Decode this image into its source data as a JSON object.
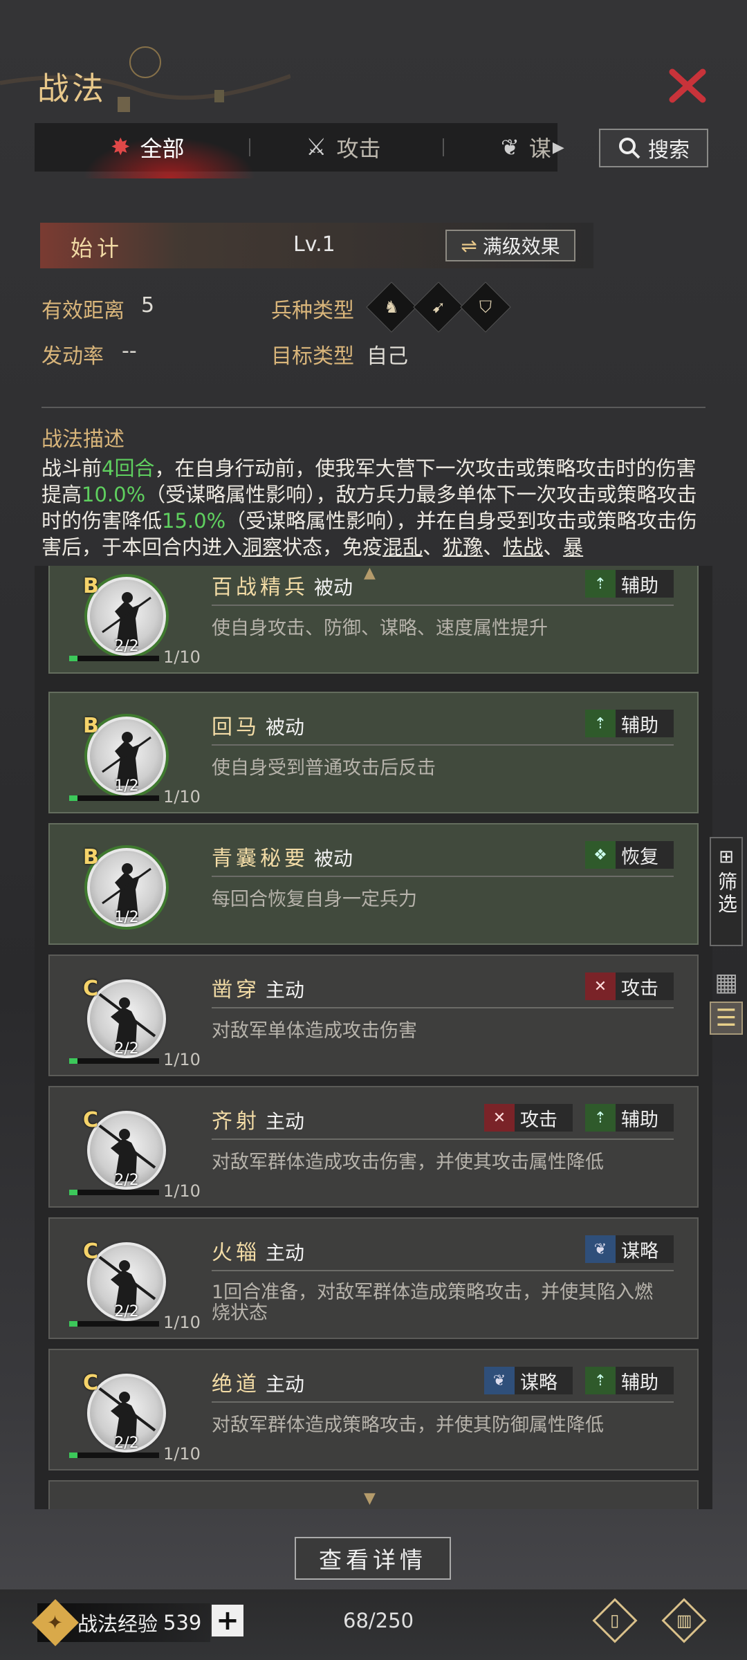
{
  "header": {
    "title": "战法"
  },
  "tabs": [
    {
      "label": "全部",
      "active": true
    },
    {
      "label": "攻击",
      "active": false
    },
    {
      "label": "谋",
      "active": false
    }
  ],
  "search": {
    "label": "搜索"
  },
  "skill": {
    "name": "始计",
    "level": "Lv.1",
    "max_effect_label": "满级效果",
    "range_label": "有效距离",
    "range_value": "5",
    "troop_label": "兵种类型",
    "rate_label": "发动率",
    "rate_value": "--",
    "target_label": "目标类型",
    "target_value": "自己",
    "desc_title": "战法描述",
    "desc": {
      "p1": "战斗前",
      "n1": "4回合",
      "p2": "，在自身行动前，使我军大营下一次攻击或策略攻击时的伤害提高",
      "n2": "10.0%",
      "p3": "（受谋略属性影响），敌方兵力最多单体下一次攻击或策略攻击时的伤害降低",
      "n3": "15.0%",
      "p4": "（受谋略属性影响），并在自身受到攻击或策略攻击伤害后，于本回合内进入",
      "u1": "洞察",
      "p5": "状态，免疫",
      "u2": "混乱",
      "s1": "、",
      "u3": "犹豫",
      "s2": "、",
      "u4": "怯战",
      "s3": "、",
      "u5": "暴"
    }
  },
  "cards": [
    {
      "grade": "B",
      "name": "百战精兵",
      "type": "被动",
      "desc": "使自身攻击、防御、谋略、速度属性提升",
      "count": "2/2",
      "level": "1/10",
      "progress": 0.1,
      "tags": [
        {
          "label": "辅助",
          "icon": "fz"
        }
      ]
    },
    {
      "grade": "B",
      "name": "回马",
      "type": "被动",
      "desc": "使自身受到普通攻击后反击",
      "count": "1/2",
      "level": "1/10",
      "progress": 0.1,
      "tags": [
        {
          "label": "辅助",
          "icon": "fz"
        }
      ]
    },
    {
      "grade": "B",
      "name": "青囊秘要",
      "type": "被动",
      "desc": "每回合恢复自身一定兵力",
      "count": "1/2",
      "level": "",
      "progress": null,
      "tags": [
        {
          "label": "恢复",
          "icon": "hf"
        }
      ]
    },
    {
      "grade": "C",
      "name": "凿穿",
      "type": "主动",
      "desc": "对敌军单体造成攻击伤害",
      "count": "2/2",
      "level": "1/10",
      "progress": 0.1,
      "tags": [
        {
          "label": "攻击",
          "icon": "gj"
        }
      ]
    },
    {
      "grade": "C",
      "name": "齐射",
      "type": "主动",
      "desc": "对敌军群体造成攻击伤害，并使其攻击属性降低",
      "count": "2/2",
      "level": "1/10",
      "progress": 0.1,
      "tags": [
        {
          "label": "攻击",
          "icon": "gj"
        },
        {
          "label": "辅助",
          "icon": "fz"
        }
      ]
    },
    {
      "grade": "C",
      "name": "火辎",
      "type": "主动",
      "desc": "1回合准备，对敌军群体造成策略攻击，并使其陷入燃烧状态",
      "count": "2/2",
      "level": "1/10",
      "progress": 0.1,
      "tags": [
        {
          "label": "谋略",
          "icon": "ml"
        }
      ]
    },
    {
      "grade": "C",
      "name": "绝道",
      "type": "主动",
      "desc": "对敌军群体造成策略攻击，并使其防御属性降低",
      "count": "2/2",
      "level": "1/10",
      "progress": 0.1,
      "tags": [
        {
          "label": "谋略",
          "icon": "ml"
        },
        {
          "label": "辅助",
          "icon": "fz"
        }
      ]
    }
  ],
  "side": {
    "filter_label": "筛选"
  },
  "detail_button": {
    "label": "查看详情"
  },
  "footer": {
    "exp_label": "战法经验",
    "exp_value": "539",
    "plus": "+",
    "count": "68/250"
  }
}
